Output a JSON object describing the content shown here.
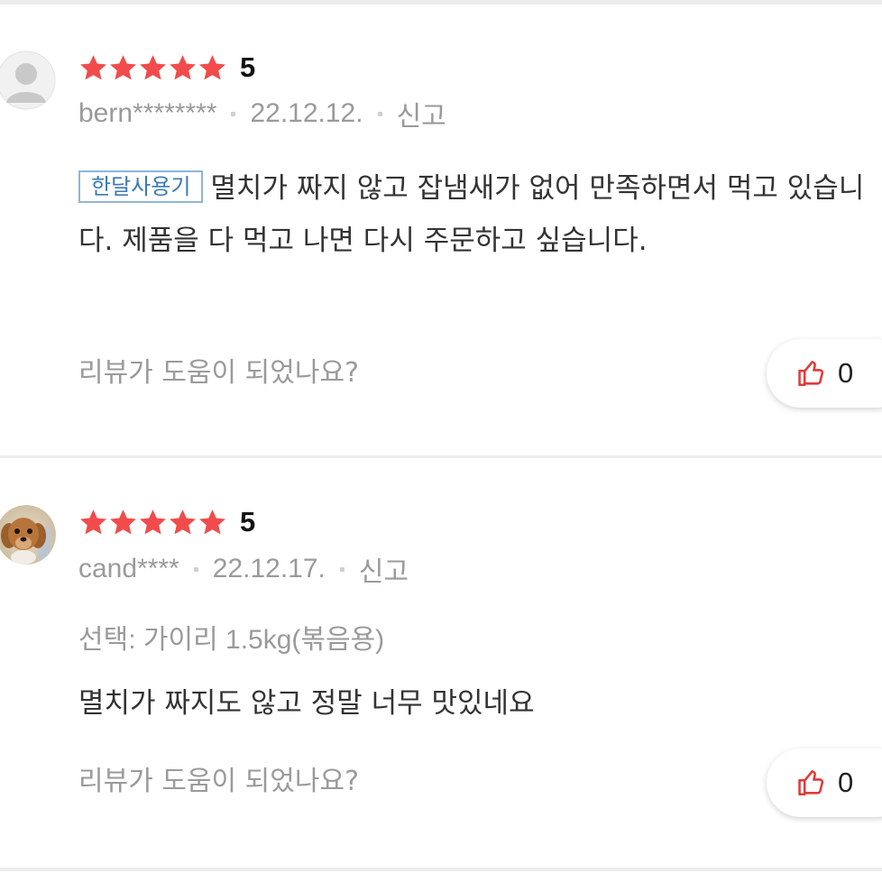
{
  "colors": {
    "star": "#f24b4b",
    "tag_border": "#8fb6d6",
    "tag_text": "#3a7ab5",
    "muted_text": "#9a9a9a",
    "like_icon": "#e03a3a"
  },
  "reviews": [
    {
      "rating": "5",
      "stars": 5,
      "avatar": "default-user-icon",
      "username": "bern********",
      "date": "22.12.12.",
      "report": "신고",
      "tag": "한달사용기",
      "text": "멸치가 짜지 않고 잡냄새가 없어 만족하면서 먹고 있습니다. 제품을 다 먹고 나면 다시 주문하고 싶습니다.",
      "helpful_prompt": "리뷰가 도움이 되었나요?",
      "like_count": "0"
    },
    {
      "rating": "5",
      "stars": 5,
      "avatar": "dog-photo-avatar",
      "username": "cand****",
      "date": "22.12.17.",
      "report": "신고",
      "option": "선택: 가이리 1.5kg(볶음용)",
      "text": "멸치가 짜지도 않고 정말 너무 맛있네요",
      "helpful_prompt": "리뷰가 도움이 되었나요?",
      "like_count": "0"
    }
  ]
}
